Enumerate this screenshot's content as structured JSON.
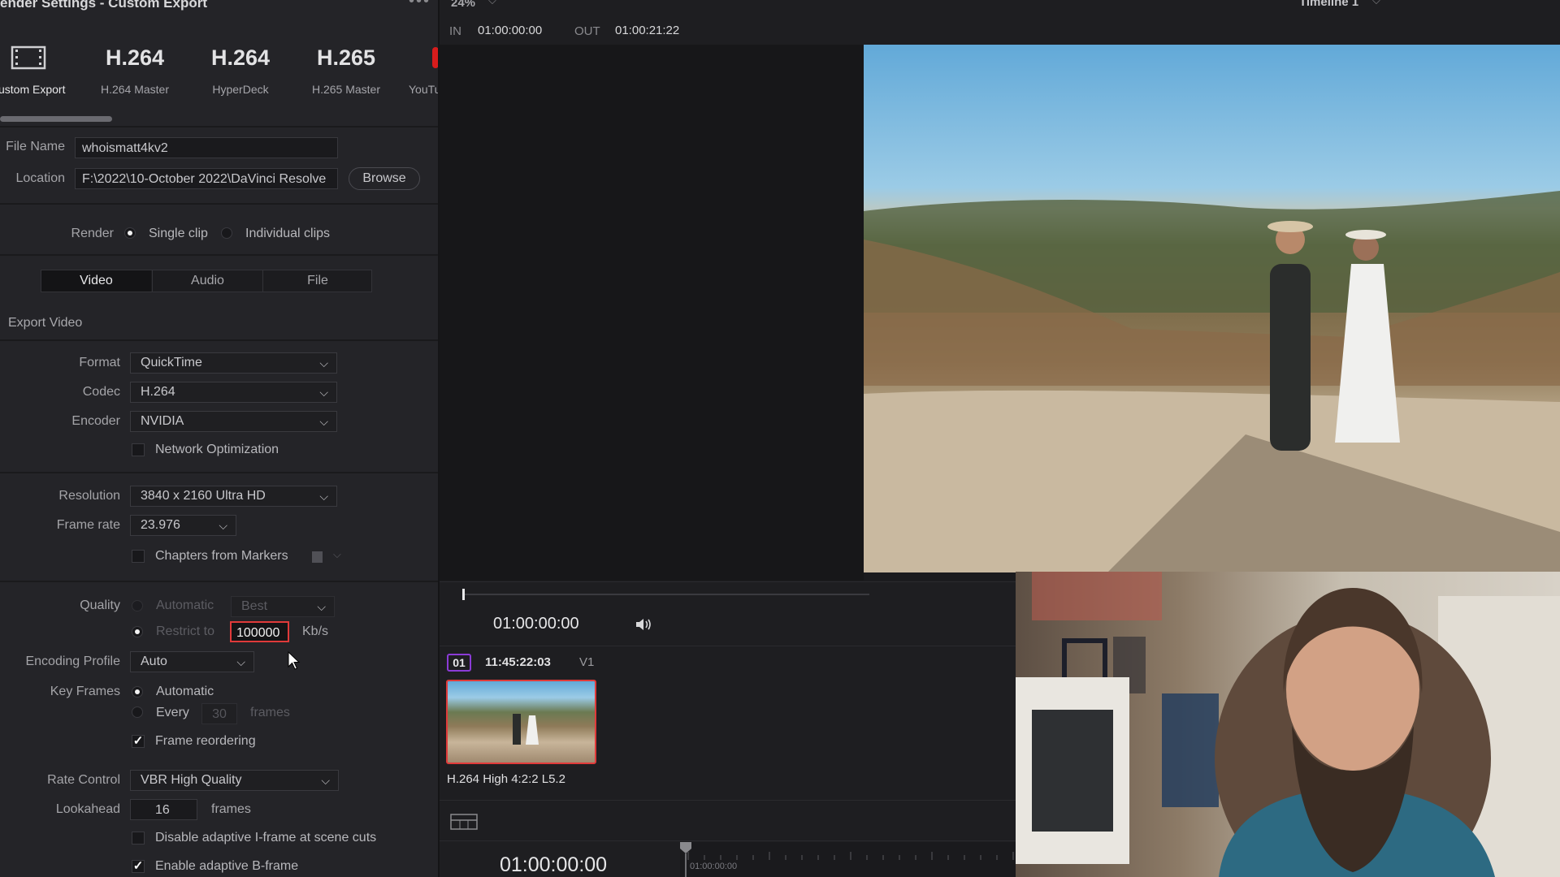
{
  "window": {
    "title": "ender Settings - Custom Export",
    "zoom": "24%",
    "timeline_name": "Timeline 1"
  },
  "presets": [
    {
      "big": "",
      "label": "ustom Export",
      "icon": "film-icon"
    },
    {
      "big": "H.264",
      "label": "H.264 Master"
    },
    {
      "big": "H.264",
      "label": "HyperDeck"
    },
    {
      "big": "H.265",
      "label": "H.265 Master"
    },
    {
      "big": "",
      "label": "YouTu"
    }
  ],
  "file": {
    "name_label": "File Name",
    "name_value": "whoismatt4kv2",
    "location_label": "Location",
    "location_value": "F:\\2022\\10-October 2022\\DaVinci Resolve",
    "browse": "Browse"
  },
  "render": {
    "label": "Render",
    "single": "Single clip",
    "individual": "Individual clips",
    "selected": "single"
  },
  "tabs": [
    "Video",
    "Audio",
    "File"
  ],
  "export_video_label": "Export Video",
  "video": {
    "format_label": "Format",
    "format": "QuickTime",
    "codec_label": "Codec",
    "codec": "H.264",
    "encoder_label": "Encoder",
    "encoder": "NVIDIA",
    "network_opt": "Network Optimization",
    "resolution_label": "Resolution",
    "resolution": "3840 x 2160 Ultra HD",
    "framerate_label": "Frame rate",
    "framerate": "23.976",
    "chapters": "Chapters from Markers",
    "quality_label": "Quality",
    "quality_auto": "Automatic",
    "quality_best": "Best",
    "restrict_label": "Restrict to",
    "restrict_value": "100000",
    "restrict_unit": "Kb/s",
    "encoding_profile_label": "Encoding Profile",
    "encoding_profile": "Auto",
    "keyframes_label": "Key Frames",
    "keyframes_auto": "Automatic",
    "keyframes_every": "Every",
    "keyframes_value": "30",
    "keyframes_unit": "frames",
    "frame_reordering": "Frame reordering",
    "rate_control_label": "Rate Control",
    "rate_control": "VBR High Quality",
    "lookahead_label": "Lookahead",
    "lookahead_value": "16",
    "lookahead_unit": "frames",
    "disable_iframe": "Disable adaptive I-frame at scene cuts",
    "enable_bframe": "Enable adaptive B-frame"
  },
  "viewer": {
    "in_label": "IN",
    "in_tc": "01:00:00:00",
    "out_label": "OUT",
    "out_tc": "01:00:21:22",
    "timecode": "01:00:00:00"
  },
  "clip": {
    "number": "01",
    "tc": "11:45:22:03",
    "track": "V1",
    "codec": "H.264 High 4:2:2 L5.2"
  },
  "timeline": {
    "timecode": "01:00:00:00",
    "ruler_tc": "01:00:00:00"
  },
  "colors": {
    "accent_red": "#d81c1c",
    "clip_border": "#e03a3a"
  }
}
